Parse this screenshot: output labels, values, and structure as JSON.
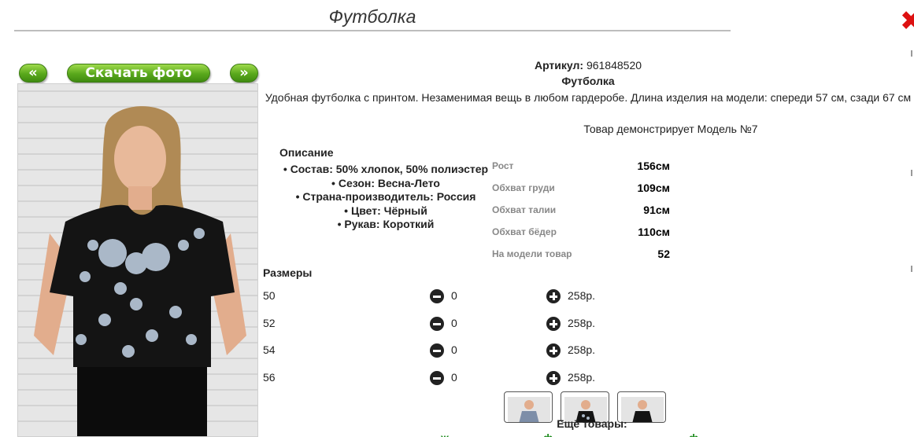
{
  "header": {
    "title": "Футболка"
  },
  "gallery": {
    "prev_label": "«",
    "download_label": "Скачать фото",
    "next_label": "»"
  },
  "product": {
    "article_label": "Артикул:",
    "article_value": "961848520",
    "name": "Футболка",
    "description": "Удобная футболка с принтом. Незаменимая вещь в любом гардеробе. Длина изделия на модели: спереди 57 см, сзади 67 см",
    "model_line": "Товар демонстрирует Модель №7"
  },
  "features": {
    "title": "Описание",
    "items": [
      "Состав: 50% хлопок, 50% полиэстер",
      "Сезон: Весна-Лето",
      "Страна-производитель: Россия",
      "Цвет: Чёрный",
      "Рукав: Короткий"
    ]
  },
  "measurements": [
    {
      "label": "Рост",
      "value": "156см"
    },
    {
      "label": "Обхват груди",
      "value": "109см"
    },
    {
      "label": "Обхват талии",
      "value": "91см"
    },
    {
      "label": "Обхват бёдер",
      "value": "110см"
    },
    {
      "label": "На модели товар",
      "value": "52"
    }
  ],
  "sizes": {
    "title": "Размеры",
    "rows": [
      {
        "size": "50",
        "qty": "0",
        "price": "258р."
      },
      {
        "size": "52",
        "qty": "0",
        "price": "258р."
      },
      {
        "size": "54",
        "qty": "0",
        "price": "258р."
      },
      {
        "size": "56",
        "qty": "0",
        "price": "258р."
      }
    ]
  },
  "more": {
    "title": "Ещё товары:"
  },
  "colors": {
    "accent_green": "#59a81c",
    "close_red": "#dd1111"
  },
  "icons": {
    "close": "close-icon",
    "minus": "minus-circle-icon",
    "plus": "plus-circle-icon"
  }
}
